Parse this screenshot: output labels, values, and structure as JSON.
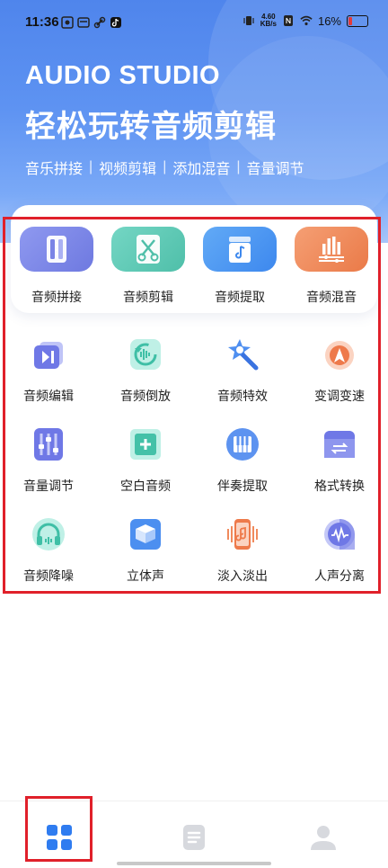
{
  "status_bar": {
    "time": "11:36",
    "net_speed_value": "4.60",
    "net_speed_unit": "KB/s",
    "battery_percent": "16%"
  },
  "header": {
    "brand": "AUDIO STUDIO",
    "slogan": "轻松玩转音频剪辑",
    "features": [
      "音乐拼接",
      "视频剪辑",
      "添加混音",
      "音量调节"
    ],
    "separator": "|"
  },
  "top_tools": [
    {
      "label": "音频拼接",
      "icon": "audio-merge-icon",
      "color": "#7b86e8"
    },
    {
      "label": "音频剪辑",
      "icon": "scissors-icon",
      "color": "#58c7b4"
    },
    {
      "label": "音频提取",
      "icon": "music-file-icon",
      "color": "#4c97f2"
    },
    {
      "label": "音频混音",
      "icon": "mixer-icon",
      "color": "#f08857"
    }
  ],
  "tools": [
    {
      "label": "音频编辑",
      "icon": "play-skip-icon"
    },
    {
      "label": "音频倒放",
      "icon": "reverse-icon"
    },
    {
      "label": "音频特效",
      "icon": "magic-wand-icon"
    },
    {
      "label": "变调变速",
      "icon": "speed-dial-icon"
    },
    {
      "label": "音量调节",
      "icon": "volume-sliders-icon"
    },
    {
      "label": "空白音频",
      "icon": "add-blank-icon"
    },
    {
      "label": "伴奏提取",
      "icon": "piano-icon"
    },
    {
      "label": "格式转换",
      "icon": "convert-icon"
    },
    {
      "label": "音频降噪",
      "icon": "headphones-icon"
    },
    {
      "label": "立体声",
      "icon": "stereo-box-icon"
    },
    {
      "label": "淡入淡出",
      "icon": "fade-phone-icon"
    },
    {
      "label": "人声分离",
      "icon": "voice-separate-icon"
    }
  ],
  "tabbar": {
    "active_tab": "home",
    "tabs": [
      {
        "name": "home",
        "icon": "grid-icon"
      },
      {
        "name": "documents",
        "icon": "document-icon"
      },
      {
        "name": "profile",
        "icon": "person-icon"
      }
    ],
    "active_color": "#2f7cf0",
    "inactive_color": "#d7d9de"
  }
}
